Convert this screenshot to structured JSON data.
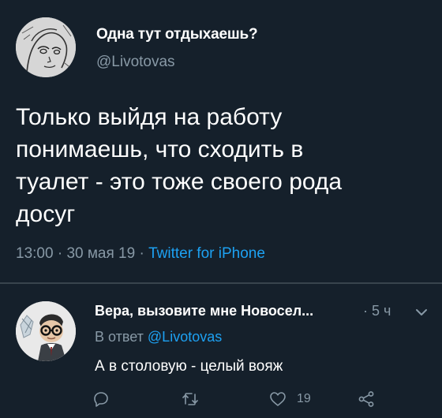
{
  "tweet": {
    "display_name": "Одна тут отдыхаешь?",
    "handle": "@Livotovas",
    "text_lines": [
      "Только выйдя на работу",
      "понимаешь, что сходить в",
      "туалет - это тоже своего рода",
      "досуг"
    ],
    "time": "13:00",
    "date": "30 мая 19",
    "separator": "·",
    "source": "Twitter for iPhone",
    "avatar_icon": "sketch-avatar-icon"
  },
  "reply": {
    "display_name": "Вера, вызовите мне Новосел...",
    "time_prefix": "·",
    "time": "5 ч",
    "replying_prefix": "В ответ",
    "replying_to": "@Livotovas",
    "text": "А в столовую - целый вояж",
    "like_count": "19",
    "avatar_icon": "man-with-glasses-avatar-icon"
  },
  "colors": {
    "background": "#15202b",
    "text": "#ffffff",
    "muted": "#8899a6",
    "accent": "#1da1f2",
    "divider": "#38444d"
  },
  "icons": [
    "chevron-down-icon",
    "reply-icon",
    "retweet-icon",
    "like-icon",
    "share-icon"
  ]
}
